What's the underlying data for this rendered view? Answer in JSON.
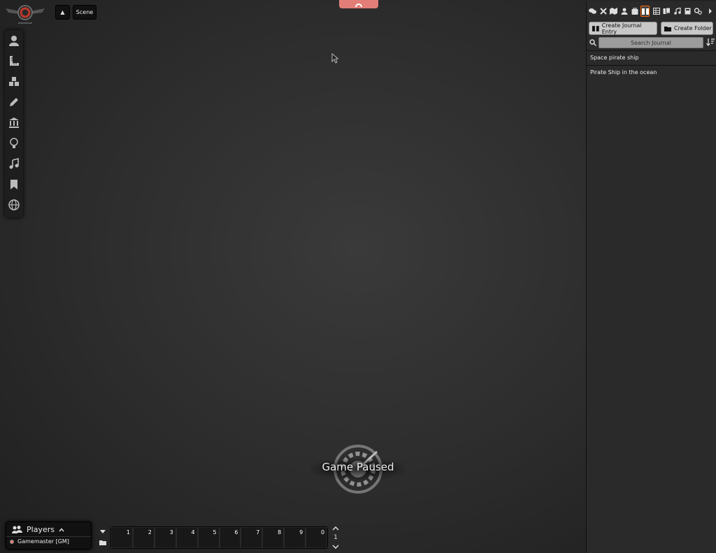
{
  "navigation": {
    "toggle_glyph": "▲",
    "scene_label": "Scene"
  },
  "controls": [
    {
      "icon": "user-icon"
    },
    {
      "icon": "ruler-icon"
    },
    {
      "icon": "cubes-icon"
    },
    {
      "icon": "pencil-icon"
    },
    {
      "icon": "landmark-icon"
    },
    {
      "icon": "lightbulb-icon"
    },
    {
      "icon": "music-icon"
    },
    {
      "icon": "bookmark-icon"
    },
    {
      "icon": "globe-icon"
    }
  ],
  "sidebar": {
    "tabs": [
      {
        "icon": "chat-icon"
      },
      {
        "icon": "combat-icon"
      },
      {
        "icon": "map-icon"
      },
      {
        "icon": "actor-icon"
      },
      {
        "icon": "suitcase-icon"
      },
      {
        "icon": "journal-icon",
        "active": true
      },
      {
        "icon": "table-icon"
      },
      {
        "icon": "cards-icon"
      },
      {
        "icon": "playlist-icon"
      },
      {
        "icon": "compendium-icon"
      },
      {
        "icon": "settings-icon"
      },
      {
        "icon": "collapse-icon"
      }
    ],
    "create_entry_label": "Create Journal Entry",
    "create_folder_label": "Create Folder",
    "search_placeholder": "Search Journal",
    "entries": [
      "Space pirate ship",
      "Pirate Ship in the ocean"
    ]
  },
  "players": {
    "title": "Players",
    "list": [
      {
        "name": "Gamemaster [GM]",
        "color": "#e37d78"
      }
    ]
  },
  "hotbar": {
    "slots": [
      "1",
      "2",
      "3",
      "4",
      "5",
      "6",
      "7",
      "8",
      "9",
      "0"
    ],
    "page": "1"
  },
  "pause": {
    "text": "Game Paused"
  },
  "colors": {
    "accent": "#e37d78",
    "active_tab_border": "#ff6400"
  }
}
